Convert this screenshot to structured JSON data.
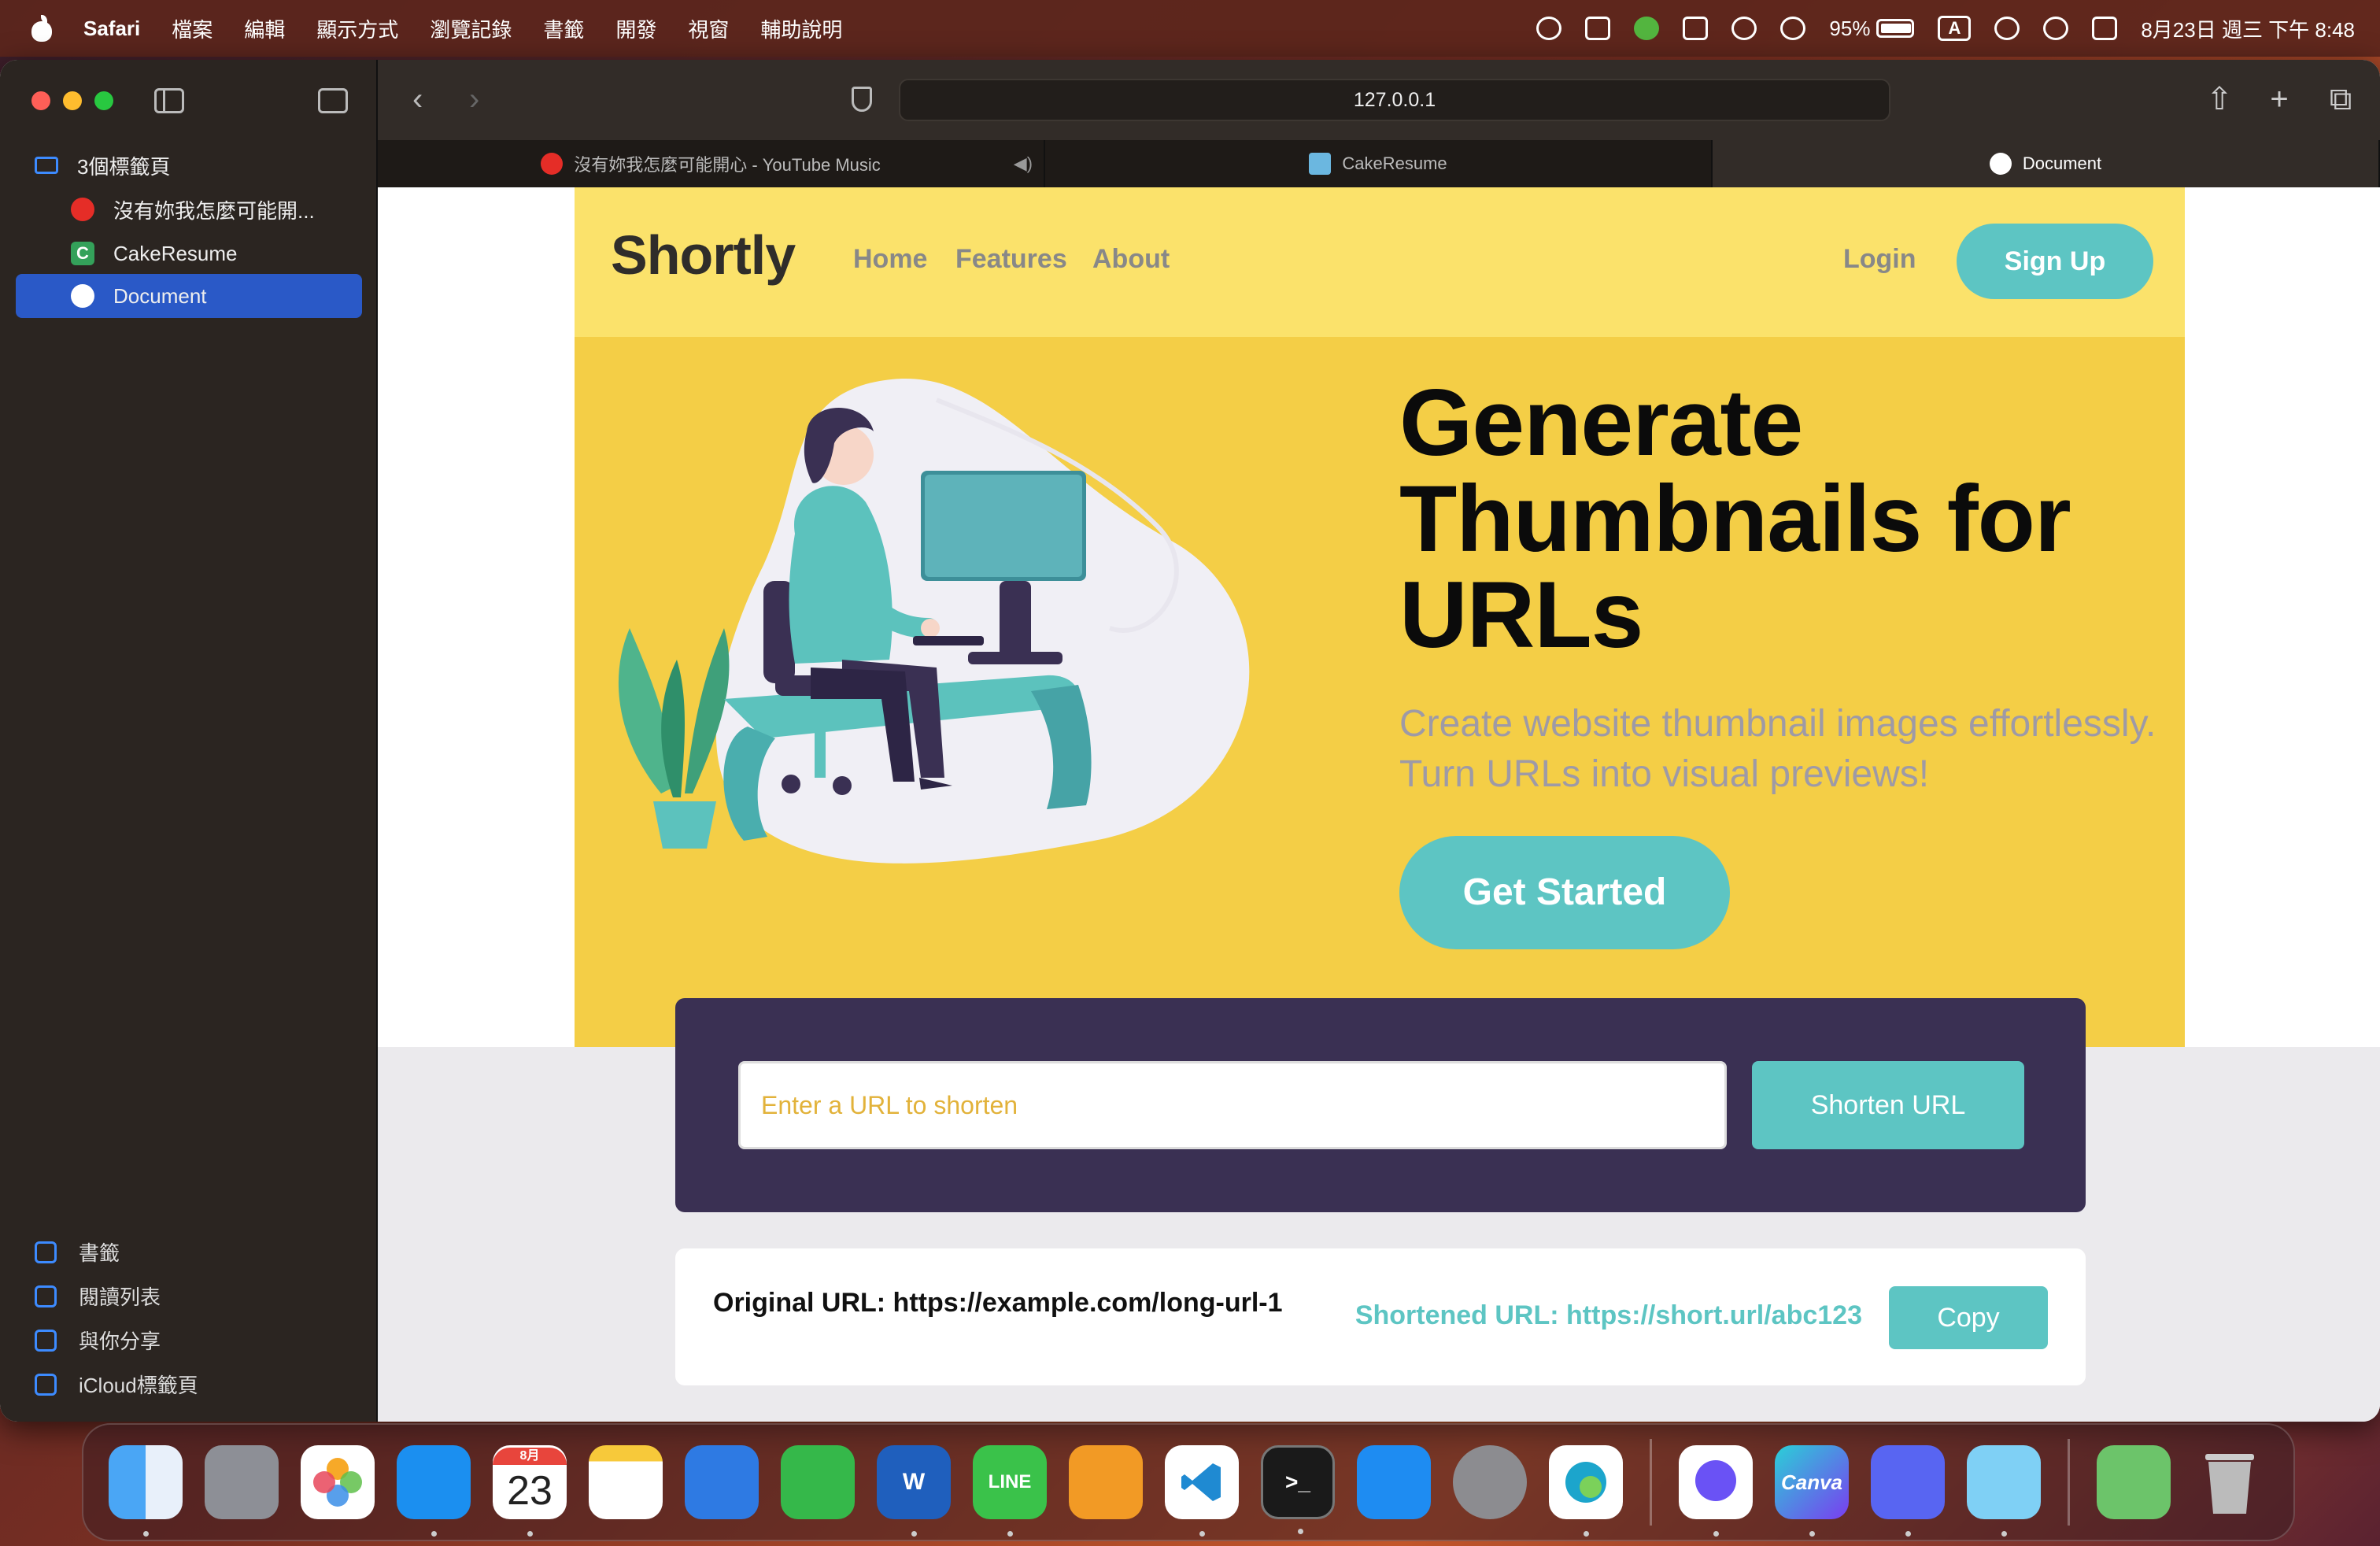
{
  "menubar": {
    "app_name": "Safari",
    "menus": [
      "檔案",
      "編輯",
      "顯示方式",
      "瀏覽記錄",
      "書籤",
      "開發",
      "視窗",
      "輔助說明"
    ],
    "battery": "95%",
    "input_method": "A",
    "clock": "8月23日 週三 下午 8:48"
  },
  "sidebar": {
    "group_label": "3個標籤頁",
    "tabs": [
      {
        "label": "沒有妳我怎麼可能開...",
        "icon": "youtube-music-icon"
      },
      {
        "label": "CakeResume",
        "icon": "cakeresume-icon"
      },
      {
        "label": "Document",
        "icon": "document-icon",
        "active": true
      }
    ],
    "bottom": [
      {
        "label": "書籤",
        "icon": "bookmark-icon"
      },
      {
        "label": "閱讀列表",
        "icon": "reading-list-icon"
      },
      {
        "label": "與你分享",
        "icon": "shared-with-you-icon"
      },
      {
        "label": "iCloud標籤頁",
        "icon": "icloud-icon"
      }
    ]
  },
  "browser": {
    "address": "127.0.0.1",
    "tabs": [
      {
        "label": "沒有妳我怎麼可能開心 - YouTube Music"
      },
      {
        "label": "CakeResume"
      },
      {
        "label": "Document"
      }
    ]
  },
  "site": {
    "logo": "Shortly",
    "nav": [
      "Home",
      "Features",
      "About"
    ],
    "login": "Login",
    "signup": "Sign Up",
    "headline": "Generate Thumbnails for URLs",
    "subtext": "Create website thumbnail images effortlessly. Turn URLs into visual previews!",
    "cta": "Get Started",
    "shorten": {
      "placeholder": "Enter a URL to shorten",
      "button": "Shorten URL"
    },
    "result": {
      "original": "Original URL: https://example.com/long-url-1",
      "shortened": "Shortened URL: https://short.url/abc123",
      "copy": "Copy"
    }
  },
  "dock": {
    "calendar_month": "8月",
    "calendar_day": "23",
    "canva_label": "Canva",
    "line_label": "LINE",
    "word_label": "W"
  },
  "colors": {
    "accent_teal": "#5dc5c3",
    "header_yellow": "#fbe26b",
    "hero_yellow": "#f4ce46",
    "panel_purple": "#3a3053"
  }
}
